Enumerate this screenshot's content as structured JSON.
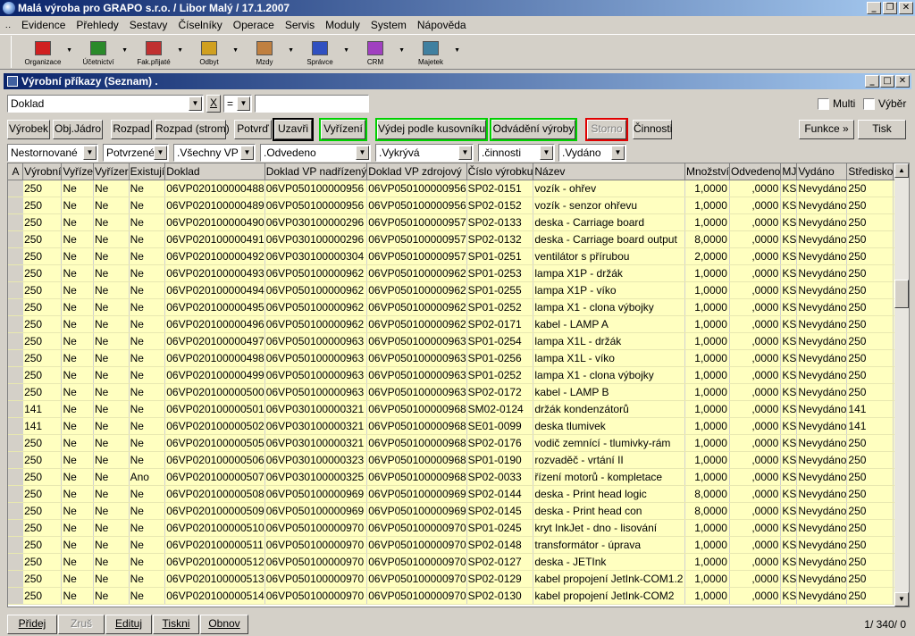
{
  "app": {
    "title": "Malá výroba pro GRAPO s.r.o. / Libor Malý / 17.1.2007"
  },
  "menu": [
    "Evidence",
    "Přehledy",
    "Sestavy",
    "Číselníky",
    "Operace",
    "Servis",
    "Moduly",
    "System",
    "Nápověda"
  ],
  "toolbar": [
    {
      "label": "Organizace",
      "icon": "organization-icon",
      "color": "#d02020"
    },
    {
      "label": "Účetnictví",
      "icon": "accounting-icon",
      "color": "#2a8a2a"
    },
    {
      "label": "Fak.přijaté",
      "icon": "invoice-icon",
      "color": "#c03030"
    },
    {
      "label": "Odbyt",
      "icon": "sales-icon",
      "color": "#d0a020"
    },
    {
      "label": "Mzdy",
      "icon": "payroll-icon",
      "color": "#c08040"
    },
    {
      "label": "Správce",
      "icon": "admin-icon",
      "color": "#3050c0"
    },
    {
      "label": "CRM",
      "icon": "crm-icon",
      "color": "#a040c0"
    },
    {
      "label": "Majetek",
      "icon": "property-icon",
      "color": "#4080a0"
    }
  ],
  "window": {
    "title": "Výrobní příkazy (Seznam) ."
  },
  "filter": {
    "field": "Doklad",
    "clear": "X",
    "operator": "=",
    "value": ""
  },
  "checkboxes": {
    "multi": "Multi",
    "vyber": "Výběr"
  },
  "buttons": {
    "vyrobek": "Výrobek",
    "objjadro": "Obj.Jádro",
    "rozpad": "Rozpad",
    "rozpadstrom": "Rozpad (strom)",
    "potvrd": "Potvrď",
    "uzavri": "Uzavři",
    "vyrizeni": "Vyřízení",
    "vydej": "Výdej podle kusovníku",
    "odvadeni": "Odvádění výroby",
    "storno": "Storno",
    "cinnosti": "Činnosti",
    "funkce": "Funkce »",
    "tisk": "Tisk"
  },
  "dropdowns": [
    "Nestornované",
    "Potvrzené",
    ".Všechny VP",
    ".Odvedeno",
    ".Vykrývá",
    ".činnosti",
    ".Vydáno"
  ],
  "table": {
    "headers": [
      "A",
      "Výrobní",
      "Vyříze",
      "Vyřízer",
      "Existují",
      "Doklad",
      "Doklad VP nadřízený",
      "Doklad VP zdrojový",
      "Číslo výrobku",
      "Název",
      "Množství",
      "Odvedeno",
      "MJ",
      "Vydáno",
      "Středisko"
    ],
    "rows": [
      [
        "",
        "250",
        "Ne",
        "Ne",
        "Ne",
        "06VP020100000488",
        "06VP050100000956",
        "06VP050100000956",
        "SP02-0151",
        "vozík - ohřev",
        "1,0000",
        ",0000",
        "KS",
        "Nevydáno",
        "250"
      ],
      [
        "",
        "250",
        "Ne",
        "Ne",
        "Ne",
        "06VP020100000489",
        "06VP050100000956",
        "06VP050100000956",
        "SP02-0152",
        "vozík - senzor ohřevu",
        "1,0000",
        ",0000",
        "KS",
        "Nevydáno",
        "250"
      ],
      [
        "",
        "250",
        "Ne",
        "Ne",
        "Ne",
        "06VP020100000490",
        "06VP030100000296",
        "06VP050100000957",
        "SP02-0133",
        "deska - Carriage board",
        "1,0000",
        ",0000",
        "KS",
        "Nevydáno",
        "250"
      ],
      [
        "",
        "250",
        "Ne",
        "Ne",
        "Ne",
        "06VP020100000491",
        "06VP030100000296",
        "06VP050100000957",
        "SP02-0132",
        "deska - Carriage board output",
        "8,0000",
        ",0000",
        "KS",
        "Nevydáno",
        "250"
      ],
      [
        "",
        "250",
        "Ne",
        "Ne",
        "Ne",
        "06VP020100000492",
        "06VP030100000304",
        "06VP050100000957",
        "SP01-0251",
        "ventilátor s přírubou",
        "2,0000",
        ",0000",
        "KS",
        "Nevydáno",
        "250"
      ],
      [
        "",
        "250",
        "Ne",
        "Ne",
        "Ne",
        "06VP020100000493",
        "06VP050100000962",
        "06VP050100000962",
        "SP01-0253",
        "lampa X1P - držák",
        "1,0000",
        ",0000",
        "KS",
        "Nevydáno",
        "250"
      ],
      [
        "",
        "250",
        "Ne",
        "Ne",
        "Ne",
        "06VP020100000494",
        "06VP050100000962",
        "06VP050100000962",
        "SP01-0255",
        "lampa X1P - víko",
        "1,0000",
        ",0000",
        "KS",
        "Nevydáno",
        "250"
      ],
      [
        "",
        "250",
        "Ne",
        "Ne",
        "Ne",
        "06VP020100000495",
        "06VP050100000962",
        "06VP050100000962",
        "SP01-0252",
        "lampa X1 - clona výbojky",
        "1,0000",
        ",0000",
        "KS",
        "Nevydáno",
        "250"
      ],
      [
        "",
        "250",
        "Ne",
        "Ne",
        "Ne",
        "06VP020100000496",
        "06VP050100000962",
        "06VP050100000962",
        "SP02-0171",
        "kabel - LAMP A",
        "1,0000",
        ",0000",
        "KS",
        "Nevydáno",
        "250"
      ],
      [
        "",
        "250",
        "Ne",
        "Ne",
        "Ne",
        "06VP020100000497",
        "06VP050100000963",
        "06VP050100000963",
        "SP01-0254",
        "lampa X1L - držák",
        "1,0000",
        ",0000",
        "KS",
        "Nevydáno",
        "250"
      ],
      [
        "",
        "250",
        "Ne",
        "Ne",
        "Ne",
        "06VP020100000498",
        "06VP050100000963",
        "06VP050100000963",
        "SP01-0256",
        "lampa X1L - víko",
        "1,0000",
        ",0000",
        "KS",
        "Nevydáno",
        "250"
      ],
      [
        "",
        "250",
        "Ne",
        "Ne",
        "Ne",
        "06VP020100000499",
        "06VP050100000963",
        "06VP050100000963",
        "SP01-0252",
        "lampa X1 - clona výbojky",
        "1,0000",
        ",0000",
        "KS",
        "Nevydáno",
        "250"
      ],
      [
        "",
        "250",
        "Ne",
        "Ne",
        "Ne",
        "06VP020100000500",
        "06VP050100000963",
        "06VP050100000963",
        "SP02-0172",
        "kabel - LAMP B",
        "1,0000",
        ",0000",
        "KS",
        "Nevydáno",
        "250"
      ],
      [
        "",
        "141",
        "Ne",
        "Ne",
        "Ne",
        "06VP020100000501",
        "06VP030100000321",
        "06VP050100000968",
        "SM02-0124",
        "držák kondenzátorů",
        "1,0000",
        ",0000",
        "KS",
        "Nevydáno",
        "141"
      ],
      [
        "",
        "141",
        "Ne",
        "Ne",
        "Ne",
        "06VP020100000502",
        "06VP030100000321",
        "06VP050100000968",
        "SE01-0099",
        "deska tlumivek",
        "1,0000",
        ",0000",
        "KS",
        "Nevydáno",
        "141"
      ],
      [
        "",
        "250",
        "Ne",
        "Ne",
        "Ne",
        "06VP020100000505",
        "06VP030100000321",
        "06VP050100000968",
        "SP02-0176",
        "vodič zemnící - tlumivky-rám",
        "1,0000",
        ",0000",
        "KS",
        "Nevydáno",
        "250"
      ],
      [
        "",
        "250",
        "Ne",
        "Ne",
        "Ne",
        "06VP020100000506",
        "06VP030100000323",
        "06VP050100000968",
        "SP01-0190",
        "rozvaděč - vrtání II",
        "1,0000",
        ",0000",
        "KS",
        "Nevydáno",
        "250"
      ],
      [
        "",
        "250",
        "Ne",
        "Ne",
        "Ano",
        "06VP020100000507",
        "06VP030100000325",
        "06VP050100000968",
        "SP02-0033",
        "řízení motorů - kompletace",
        "1,0000",
        ",0000",
        "KS",
        "Nevydáno",
        "250"
      ],
      [
        "",
        "250",
        "Ne",
        "Ne",
        "Ne",
        "06VP020100000508",
        "06VP050100000969",
        "06VP050100000969",
        "SP02-0144",
        "deska - Print head logic",
        "8,0000",
        ",0000",
        "KS",
        "Nevydáno",
        "250"
      ],
      [
        "",
        "250",
        "Ne",
        "Ne",
        "Ne",
        "06VP020100000509",
        "06VP050100000969",
        "06VP050100000969",
        "SP02-0145",
        "deska - Print head con",
        "8,0000",
        ",0000",
        "KS",
        "Nevydáno",
        "250"
      ],
      [
        "",
        "250",
        "Ne",
        "Ne",
        "Ne",
        "06VP020100000510",
        "06VP050100000970",
        "06VP050100000970",
        "SP01-0245",
        "kryt InkJet - dno - lisování",
        "1,0000",
        ",0000",
        "KS",
        "Nevydáno",
        "250"
      ],
      [
        "",
        "250",
        "Ne",
        "Ne",
        "Ne",
        "06VP020100000511",
        "06VP050100000970",
        "06VP050100000970",
        "SP02-0148",
        "transformátor - úprava",
        "1,0000",
        ",0000",
        "KS",
        "Nevydáno",
        "250"
      ],
      [
        "",
        "250",
        "Ne",
        "Ne",
        "Ne",
        "06VP020100000512",
        "06VP050100000970",
        "06VP050100000970",
        "SP02-0127",
        "deska - JETInk",
        "1,0000",
        ",0000",
        "KS",
        "Nevydáno",
        "250"
      ],
      [
        "",
        "250",
        "Ne",
        "Ne",
        "Ne",
        "06VP020100000513",
        "06VP050100000970",
        "06VP050100000970",
        "SP02-0129",
        "kabel propojení JetInk-COM1.2",
        "1,0000",
        ",0000",
        "KS",
        "Nevydáno",
        "250"
      ],
      [
        "",
        "250",
        "Ne",
        "Ne",
        "Ne",
        "06VP020100000514",
        "06VP050100000970",
        "06VP050100000970",
        "SP02-0130",
        "kabel propojení JetInk-COM2",
        "1,0000",
        ",0000",
        "KS",
        "Nevydáno",
        "250"
      ]
    ]
  },
  "bottom": {
    "pridej": "Přidej",
    "zrus": "Zruš",
    "edituj": "Edituj",
    "tiskni": "Tiskni",
    "obnov": "Obnov",
    "status": "1/ 340/  0"
  }
}
